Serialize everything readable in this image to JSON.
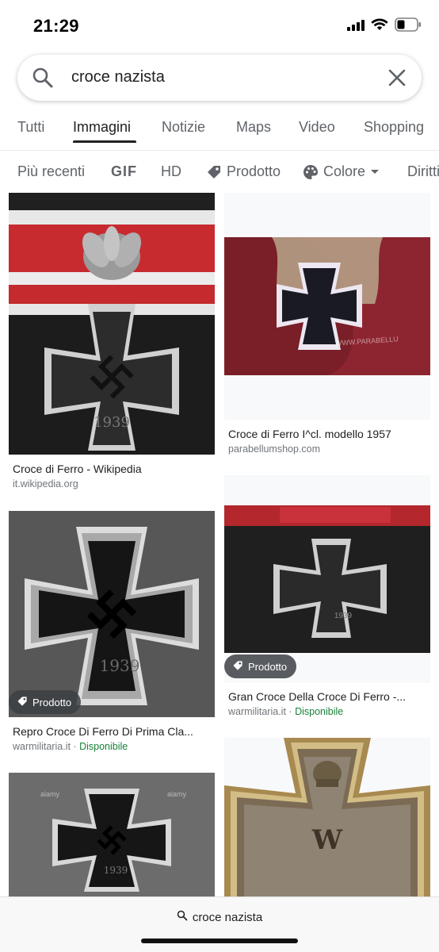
{
  "status_bar": {
    "time": "21:29"
  },
  "search": {
    "query": "croce nazista"
  },
  "tabs": [
    {
      "label": "Tutti",
      "active": false
    },
    {
      "label": "Immagini",
      "active": true
    },
    {
      "label": "Notizie",
      "active": false
    },
    {
      "label": "Maps",
      "active": false
    },
    {
      "label": "Video",
      "active": false
    },
    {
      "label": "Shopping",
      "active": false
    }
  ],
  "filters": [
    {
      "label": "Più recenti",
      "icon": ""
    },
    {
      "label": "GIF",
      "icon": ""
    },
    {
      "label": "HD",
      "icon": ""
    },
    {
      "label": "Prodotto",
      "icon": "tag-icon"
    },
    {
      "label": "Colore",
      "icon": "palette-icon"
    },
    {
      "label": "Diritti",
      "icon": ""
    }
  ],
  "results": [
    {
      "title": "Croce di Ferro - Wikipedia",
      "source": "it.wikipedia.org",
      "availability": "",
      "badge": "",
      "year": "1939"
    },
    {
      "title": "Croce di Ferro I^cl. modello 1957",
      "source": "parabellumshop.com",
      "availability": "",
      "badge": "",
      "watermark": "WWW.PARABELLU"
    },
    {
      "title": "Repro Croce Di Ferro Di Prima Cla...",
      "source": "warmilitaria.it",
      "availability": "Disponibile",
      "badge": "Prodotto",
      "year": "1939"
    },
    {
      "title": "Gran Croce Della Croce Di Ferro -...",
      "source": "warmilitaria.it",
      "availability": "Disponibile",
      "badge": "Prodotto",
      "year": "1939"
    },
    {
      "title": "",
      "source": "",
      "availability": "",
      "badge": "",
      "year": "1939",
      "watermark": "alamy"
    },
    {
      "title": "",
      "source": "",
      "availability": "",
      "badge": "",
      "letter": "W"
    }
  ],
  "bottom_bar": {
    "query": "croce nazista"
  },
  "colors": {
    "text": "#202124",
    "secondary": "#5f6368",
    "source": "#70757a",
    "available": "#188038",
    "badge_bg": "#3c4043"
  }
}
